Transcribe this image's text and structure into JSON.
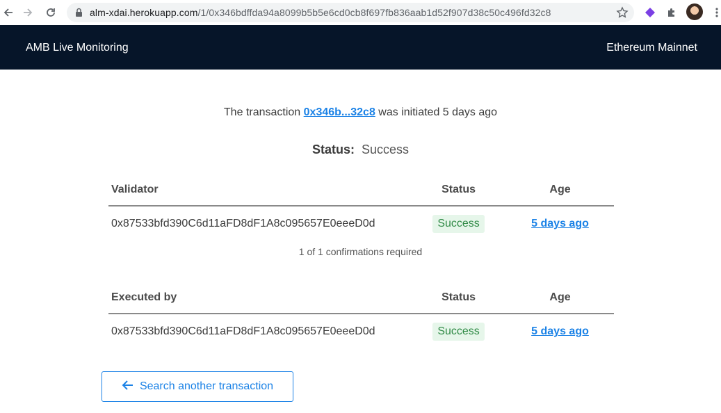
{
  "browser": {
    "url_host": "alm-xdai.herokuapp.com",
    "url_path": "/1/0x346bdffda94a8099b5b5e6cd0cb8f697fb836aab1d52f907d38c50c496fd32c8"
  },
  "header": {
    "title": "AMB Live Monitoring",
    "network": "Ethereum Mainnet"
  },
  "intro": {
    "prefix": "The transaction",
    "tx_short": "0x346b...32c8",
    "suffix": "was initiated 5 days ago"
  },
  "status": {
    "label": "Status:",
    "value": "Success"
  },
  "validators_table": {
    "headers": [
      "Validator",
      "Status",
      "Age"
    ],
    "rows": [
      {
        "address": "0x87533bfd390C6d11aFD8dF1A8c095657E0eeeD0d",
        "status": "Success",
        "age": "5 days ago"
      }
    ],
    "note": "1 of 1 confirmations required"
  },
  "executed_table": {
    "headers": [
      "Executed by",
      "Status",
      "Age"
    ],
    "rows": [
      {
        "address": "0x87533bfd390C6d11aFD8dF1A8c095657E0eeeD0d",
        "status": "Success",
        "age": "5 days ago"
      }
    ]
  },
  "back_button": {
    "label": "Search another transaction"
  },
  "colors": {
    "header_bg": "#061529",
    "link": "#1b82e6",
    "success_bg": "#e6f6ea",
    "success_text": "#2f8a45"
  },
  "icons": [
    "back-arrow-icon",
    "forward-arrow-icon",
    "reload-icon",
    "lock-icon",
    "star-icon",
    "extension-gem-icon",
    "puzzle-icon",
    "kebab-menu-icon",
    "left-arrow-icon"
  ]
}
